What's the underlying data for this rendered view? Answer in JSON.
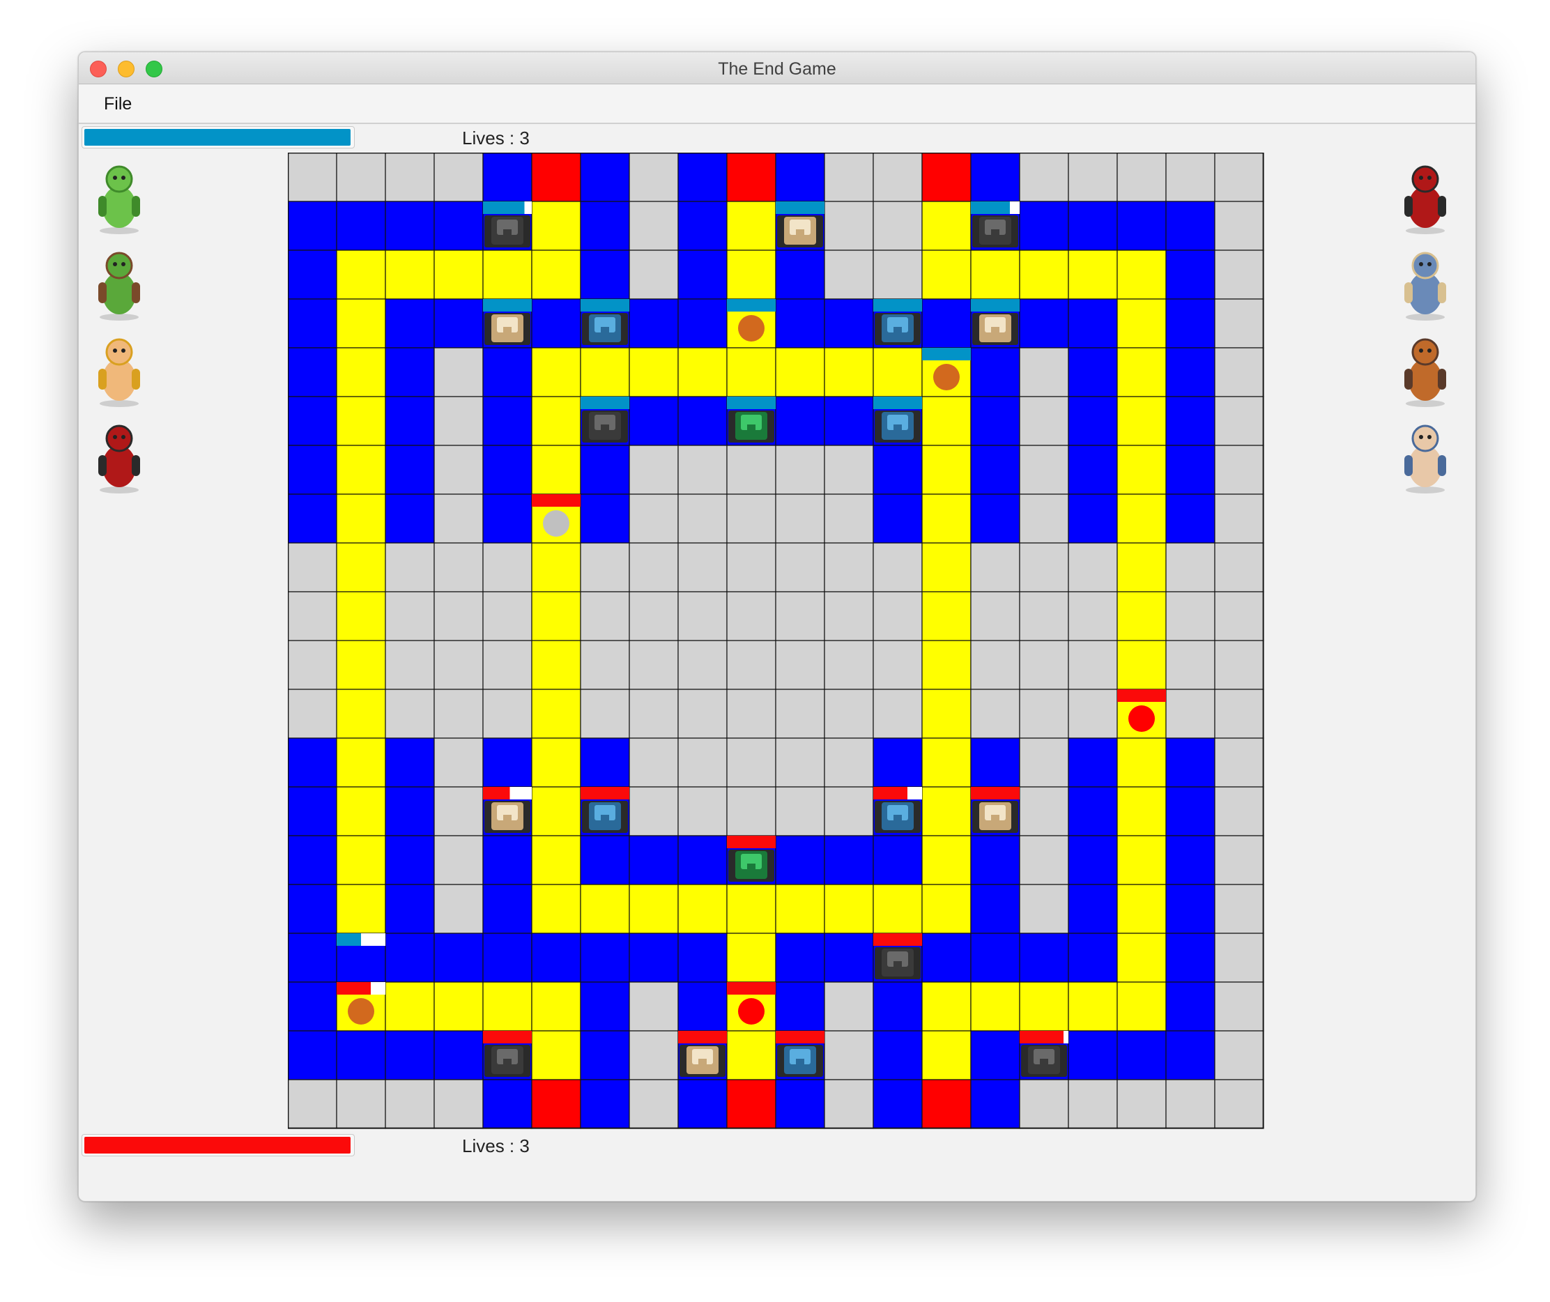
{
  "window": {
    "title": "The End Game"
  },
  "menu": {
    "file": "File"
  },
  "players": [
    {
      "lives_text": "Lives : 3",
      "health": 1.0,
      "color": "#0293c7",
      "troops": [
        "baby-dragon-icon",
        "goblin-icon",
        "barbarian-icon",
        "samurai-icon"
      ]
    },
    {
      "lives_text": "Lives : 3",
      "health": 1.0,
      "color": "#fb0a0a",
      "troops": [
        "samurai-icon",
        "miner-icon",
        "golem-icon",
        "gunner-icon"
      ]
    }
  ],
  "board": {
    "cols": 20,
    "rows": 20,
    "legend": {
      "G": "#d3d3d3",
      "B": "#0000ff",
      "Y": "#ffff00",
      "R": "#ff0000"
    },
    "grid": [
      "GGGGBRBGBRBGGRBGGGGG",
      "BBBBBYBGBYBGGYBBBBBG",
      "BYYYYYBGBYBGGYYYYYBG",
      "BYBBBBBBBYBBBBBBBYBG",
      "BYBGBYYYYYYYYYBGBYBG",
      "BYBGBYBBBBBBBYBGBYBG",
      "BYBGBYBGGGGGBYBGBYBG",
      "BYBGBYBGGGGGBYBGBYBG",
      "GYGGGYGGGGGGGYGGGYGG",
      "GYGGGYGGGGGGGYGGGYGG",
      "GYGGGYGGGGGGGYGGGYGG",
      "GYGGGYGGGGGGGYGGGYGG",
      "BYBGBYBGGGGGBYBGBYBG",
      "BYBGBYBGGGGGBYBGBYBG",
      "BYBGBYBBBBBBBYBGBYBG",
      "BYBGBYYYYYYYYYBGBYBG",
      "BBBBBBBBBYBBBBBBBYBG",
      "BYYYYYBGBYBGBYYYYYBG",
      "BBBBBYBGBYBGBYBBBBBG",
      "GGGGBRBGBRBGBRBGGGGG"
    ],
    "buildings": [
      {
        "row": 1,
        "col": 4,
        "kind": "cannon",
        "team": "blue",
        "health": 0.85
      },
      {
        "row": 1,
        "col": 10,
        "kind": "archer-tower",
        "team": "blue",
        "health": 1.0
      },
      {
        "row": 1,
        "col": 14,
        "kind": "cannon",
        "team": "blue",
        "health": 0.8
      },
      {
        "row": 3,
        "col": 4,
        "kind": "archer-tower",
        "team": "blue",
        "health": 1.0
      },
      {
        "row": 3,
        "col": 6,
        "kind": "tesla",
        "team": "blue",
        "health": 1.0
      },
      {
        "row": 3,
        "col": 9,
        "kind": "unit",
        "team": "blue",
        "health": 1.0,
        "unit": "orange"
      },
      {
        "row": 3,
        "col": 12,
        "kind": "tesla",
        "team": "blue",
        "health": 1.0
      },
      {
        "row": 3,
        "col": 14,
        "kind": "archer-tower",
        "team": "blue",
        "health": 1.0
      },
      {
        "row": 4,
        "col": 13,
        "kind": "unit",
        "team": "blue",
        "health": 1.0,
        "unit": "orange"
      },
      {
        "row": 5,
        "col": 6,
        "kind": "cannon",
        "team": "blue",
        "health": 1.0
      },
      {
        "row": 5,
        "col": 9,
        "kind": "king-tower",
        "team": "blue",
        "health": 1.0
      },
      {
        "row": 5,
        "col": 12,
        "kind": "tesla",
        "team": "blue",
        "health": 1.0
      },
      {
        "row": 7,
        "col": 5,
        "kind": "unit",
        "team": "red",
        "health": 1.0,
        "unit": "gray"
      },
      {
        "row": 11,
        "col": 17,
        "kind": "unit",
        "team": "red",
        "health": 1.0,
        "unit": "red"
      },
      {
        "row": 13,
        "col": 4,
        "kind": "archer-tower",
        "team": "red",
        "health": 0.55
      },
      {
        "row": 13,
        "col": 6,
        "kind": "tesla",
        "team": "red",
        "health": 1.0
      },
      {
        "row": 13,
        "col": 12,
        "kind": "tesla",
        "team": "red",
        "health": 0.7
      },
      {
        "row": 13,
        "col": 14,
        "kind": "archer-tower",
        "team": "red",
        "health": 1.0
      },
      {
        "row": 14,
        "col": 9,
        "kind": "king-tower",
        "team": "red",
        "health": 1.0
      },
      {
        "row": 16,
        "col": 1,
        "kind": "unit",
        "team": "blue",
        "health": 0.5,
        "unit": "blue"
      },
      {
        "row": 16,
        "col": 12,
        "kind": "cannon",
        "team": "red",
        "health": 1.0
      },
      {
        "row": 17,
        "col": 1,
        "kind": "unit",
        "team": "red",
        "health": 0.7,
        "unit": "orange"
      },
      {
        "row": 17,
        "col": 9,
        "kind": "unit",
        "team": "red",
        "health": 1.0,
        "unit": "red"
      },
      {
        "row": 18,
        "col": 4,
        "kind": "cannon",
        "team": "red",
        "health": 1.0
      },
      {
        "row": 18,
        "col": 8,
        "kind": "archer-tower",
        "team": "red",
        "health": 1.0
      },
      {
        "row": 18,
        "col": 10,
        "kind": "tesla",
        "team": "red",
        "health": 1.0
      },
      {
        "row": 18,
        "col": 15,
        "kind": "cannon",
        "team": "red",
        "health": 0.9
      }
    ]
  }
}
